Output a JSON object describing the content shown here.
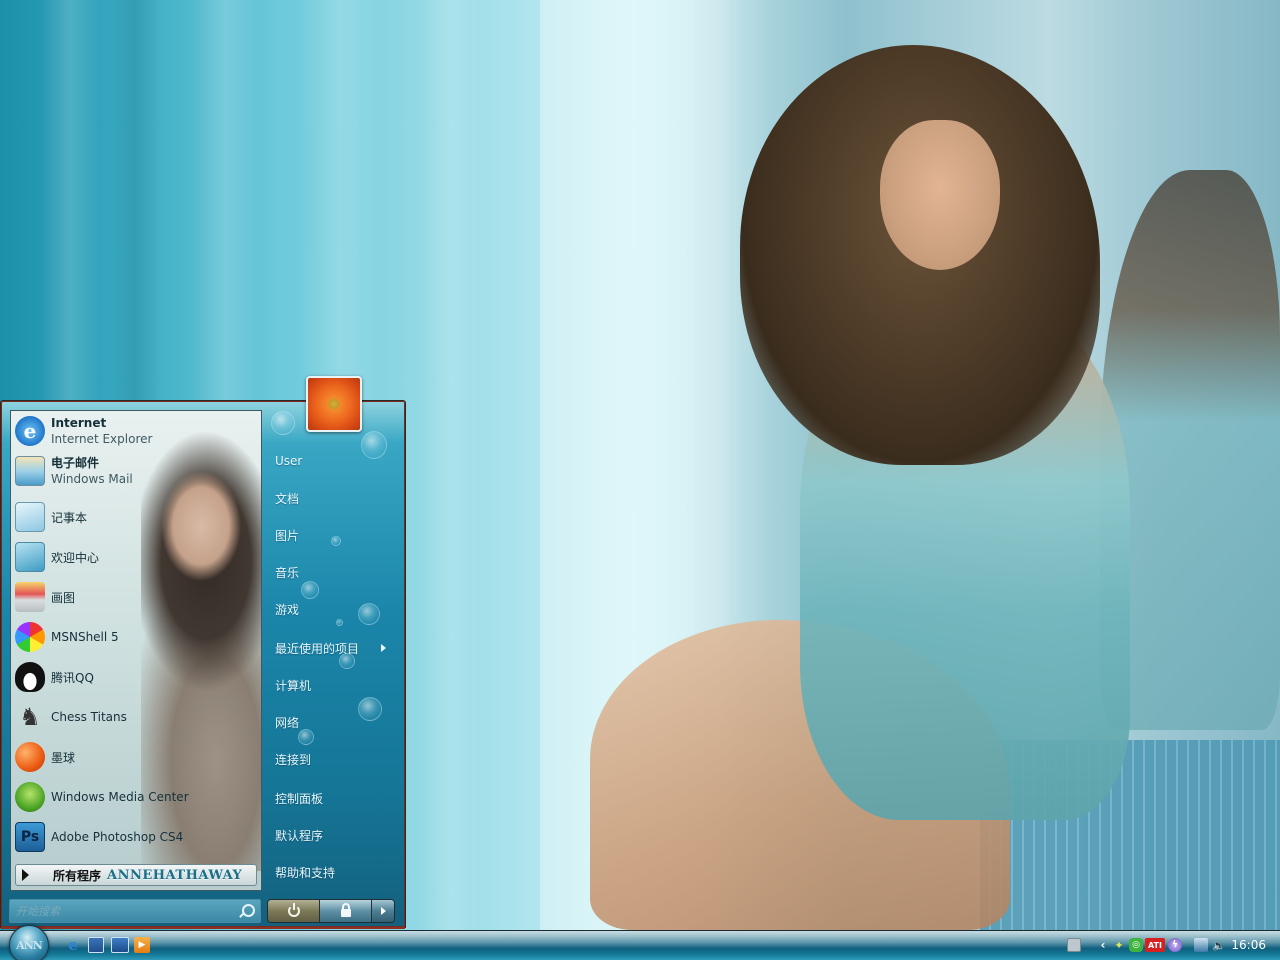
{
  "desktop": {
    "wallpaper": "anne-hathaway-wallpaper"
  },
  "start_menu": {
    "pinned_programs": [
      {
        "title": "Internet",
        "subtitle": "Internet Explorer",
        "icon": "internet-explorer-icon",
        "bold": true
      },
      {
        "title": "电子邮件",
        "subtitle": "Windows Mail",
        "icon": "windows-mail-icon",
        "bold": true
      }
    ],
    "recent_programs": [
      {
        "title": "记事本",
        "icon": "notepad-icon"
      },
      {
        "title": "欢迎中心",
        "icon": "welcome-center-icon"
      },
      {
        "title": "画图",
        "icon": "paint-icon"
      },
      {
        "title": "MSNShell 5",
        "icon": "msnshell-icon"
      },
      {
        "title": "腾讯QQ",
        "icon": "qq-penguin-icon"
      },
      {
        "title": "Chess Titans",
        "icon": "chess-icon"
      },
      {
        "title": "墨球",
        "icon": "inkball-icon"
      },
      {
        "title": "Windows Media Center",
        "icon": "media-center-icon"
      },
      {
        "title": "Adobe Photoshop CS4",
        "icon": "photoshop-icon"
      }
    ],
    "all_programs_label": "所有程序",
    "brand_text": "ANNEHATHAWAY",
    "search_placeholder": "开始搜索",
    "user_tile_icon": "flower-user-picture",
    "places": [
      {
        "label": "User"
      },
      {
        "label": "文档"
      },
      {
        "label": "图片"
      },
      {
        "label": "音乐"
      },
      {
        "label": "游戏"
      },
      {
        "label": "最近使用的项目",
        "has_submenu": true
      },
      {
        "label": "计算机"
      },
      {
        "label": "网络"
      },
      {
        "label": "连接到"
      },
      {
        "label": "控制面板"
      },
      {
        "label": "默认程序"
      },
      {
        "label": "帮助和支持"
      }
    ],
    "power_buttons": [
      "power-icon",
      "lock-icon",
      "more-options-arrow"
    ]
  },
  "taskbar": {
    "start_orb_text": "ANN",
    "quick_launch": [
      "internet-explorer-icon",
      "switch-windows-icon",
      "show-desktop-icon",
      "media-player-icon"
    ],
    "tray_icons": [
      "keyboard-icon",
      "show-hidden-icons-chevron",
      "network-satellite-icon",
      "green-app-icon",
      "ati-icon",
      "purple-app-icon",
      "network-status-icon",
      "volume-icon"
    ],
    "ati_label": "ATI",
    "clock": "16:06"
  },
  "colors": {
    "menu_blue": "#1b86aa",
    "taskbar_blue": "#0f5f7e",
    "user_tile_orange": "#ee6a1f"
  }
}
